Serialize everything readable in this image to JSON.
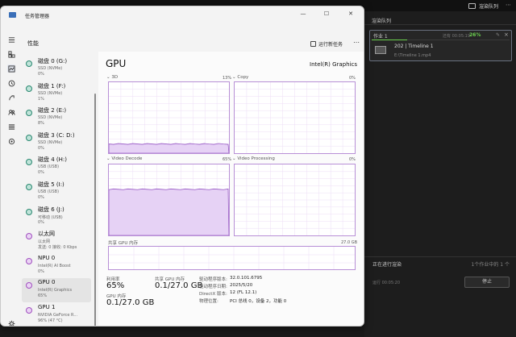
{
  "render_queue": {
    "top_button": "渲染队列",
    "header": "渲染队列",
    "job": {
      "title": "作业 1",
      "time": "还有 00:05:19",
      "percent": "26%",
      "progress_fraction": 0.26,
      "clip_name": "202 | Timeline 1",
      "clip_path": "E:\\Timeline 1.mp4"
    },
    "status": "正在进行渲染",
    "status_right": "1个作业中的 1 个",
    "elapsed": "运行 00:05:20",
    "stop_label": "停止"
  },
  "task_manager": {
    "title": "任务管理器",
    "page_title": "性能",
    "run_task_label": "运行新任务",
    "more_label": "⋯",
    "window_buttons": [
      "—",
      "☐",
      "✕"
    ],
    "devices": [
      {
        "name": "磁盘 0 (G:)",
        "sub1": "SSD (NVMe)",
        "sub2": "0%"
      },
      {
        "name": "磁盘 1 (F:)",
        "sub1": "SSD (NVMe)",
        "sub2": "1%"
      },
      {
        "name": "磁盘 2 (E:)",
        "sub1": "SSD (NVMe)",
        "sub2": "8%"
      },
      {
        "name": "磁盘 3 (C: D:)",
        "sub1": "SSD (NVMe)",
        "sub2": "0%"
      },
      {
        "name": "磁盘 4 (H:)",
        "sub1": "USB (USB)",
        "sub2": "0%"
      },
      {
        "name": "磁盘 5 (I:)",
        "sub1": "USB (USB)",
        "sub2": "0%"
      },
      {
        "name": "磁盘 6 (J:)",
        "sub1": "可移动 (USB)",
        "sub2": "0%"
      },
      {
        "name": "以太网",
        "sub1": "以太网",
        "sub2": "发送: 0 接收: 0 Kbps"
      },
      {
        "name": "NPU 0",
        "sub1": "Intel(R) AI Boost",
        "sub2": "0%"
      },
      {
        "name": "GPU 0",
        "sub1": "Intel(R) Graphics",
        "sub2": "65%"
      },
      {
        "name": "GPU 1",
        "sub1": "NVIDIA GeForce R...",
        "sub2": "96% (47 °C)"
      }
    ],
    "gpu": {
      "title": "GPU",
      "model": "Intel(R) Graphics",
      "graphs": [
        {
          "label": "3D",
          "pct": "13%",
          "level": 0.13
        },
        {
          "label": "Copy",
          "pct": "0%",
          "level": 0.0
        },
        {
          "label": "Video Decode",
          "pct": "65%",
          "level": 0.65
        },
        {
          "label": "Video Processing",
          "pct": "0%",
          "level": 0.0
        }
      ],
      "shared_mem_label": "共享 GPU 内存",
      "shared_mem_max": "27.0 GB",
      "stats": {
        "util_label": "利用率",
        "util_value": "65%",
        "shared_label": "共享 GPU 内存",
        "shared_value": "0.1/27.0 GB",
        "gpu_mem_label": "GPU 内存",
        "gpu_mem_value": "0.1/27.0 GB"
      },
      "details": [
        {
          "key": "驱动程序版本:",
          "val": "32.0.101.6795"
        },
        {
          "key": "驱动程序日期:",
          "val": "2025/5/20"
        },
        {
          "key": "DirectX 版本:",
          "val": "12 (FL 12.1)"
        },
        {
          "key": "物理位置:",
          "val": "PCI 总线 0，设备 2，功能 0"
        }
      ]
    }
  }
}
